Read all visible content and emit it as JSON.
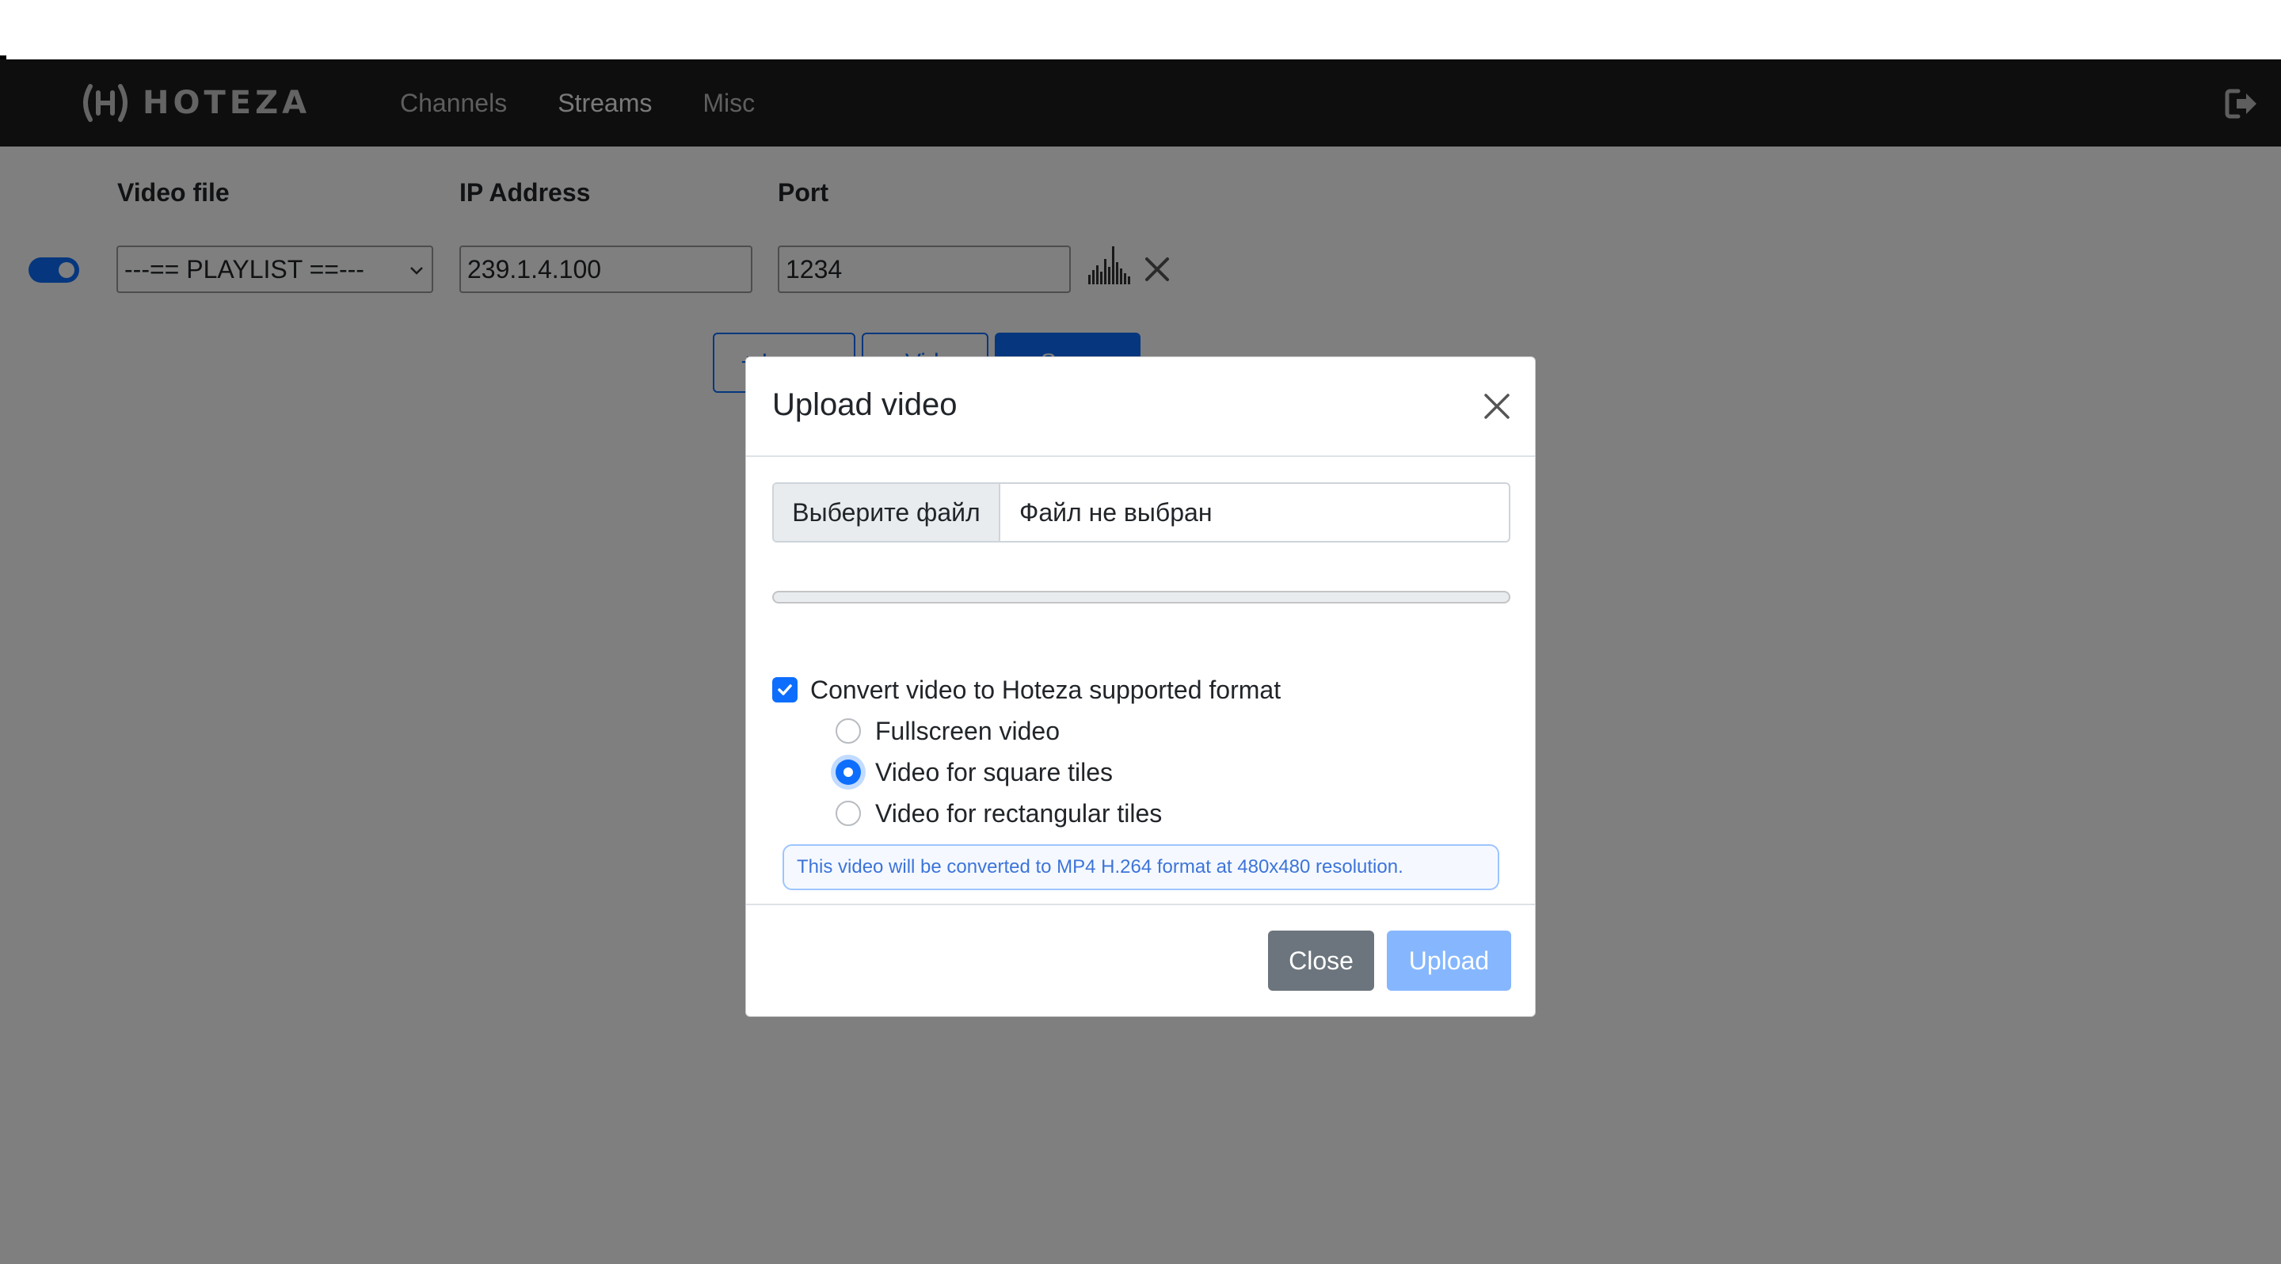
{
  "brand": {
    "name": "HOTEZA"
  },
  "nav": {
    "items": [
      {
        "label": "Channels",
        "active": false
      },
      {
        "label": "Streams",
        "active": true
      },
      {
        "label": "Misc",
        "active": false
      }
    ],
    "logout_icon": "sign-out-icon"
  },
  "stream_form": {
    "columns": {
      "video_file": "Video file",
      "ip_address": "IP Address",
      "port": "Port"
    },
    "row": {
      "enabled": true,
      "video_file_value": "---== PLAYLIST ==---",
      "ip_address_value": "239.1.4.100",
      "port_value": "1234"
    },
    "buttons": [
      {
        "label": "+ Image"
      },
      {
        "label": "+ Video"
      },
      {
        "label": "Save"
      }
    ]
  },
  "modal": {
    "title": "Upload video",
    "file_button_label": "Выберите файл",
    "file_name": "Файл не выбран",
    "progress_percent": 0,
    "convert_label": "Convert video to Hoteza supported format",
    "convert_checked": true,
    "options": [
      {
        "label": "Fullscreen video",
        "checked": false
      },
      {
        "label": "Video for square tiles",
        "checked": true
      },
      {
        "label": "Video for rectangular tiles",
        "checked": false
      }
    ],
    "info_text": "This video will be converted to MP4 H.264 format at 480x480 resolution.",
    "close_label": "Close",
    "upload_label": "Upload"
  },
  "colors": {
    "accent": "#0d6efd",
    "navbar": "#1c1c1c",
    "secondary": "#6c757d",
    "upload_disabled": "#86b7fe"
  }
}
